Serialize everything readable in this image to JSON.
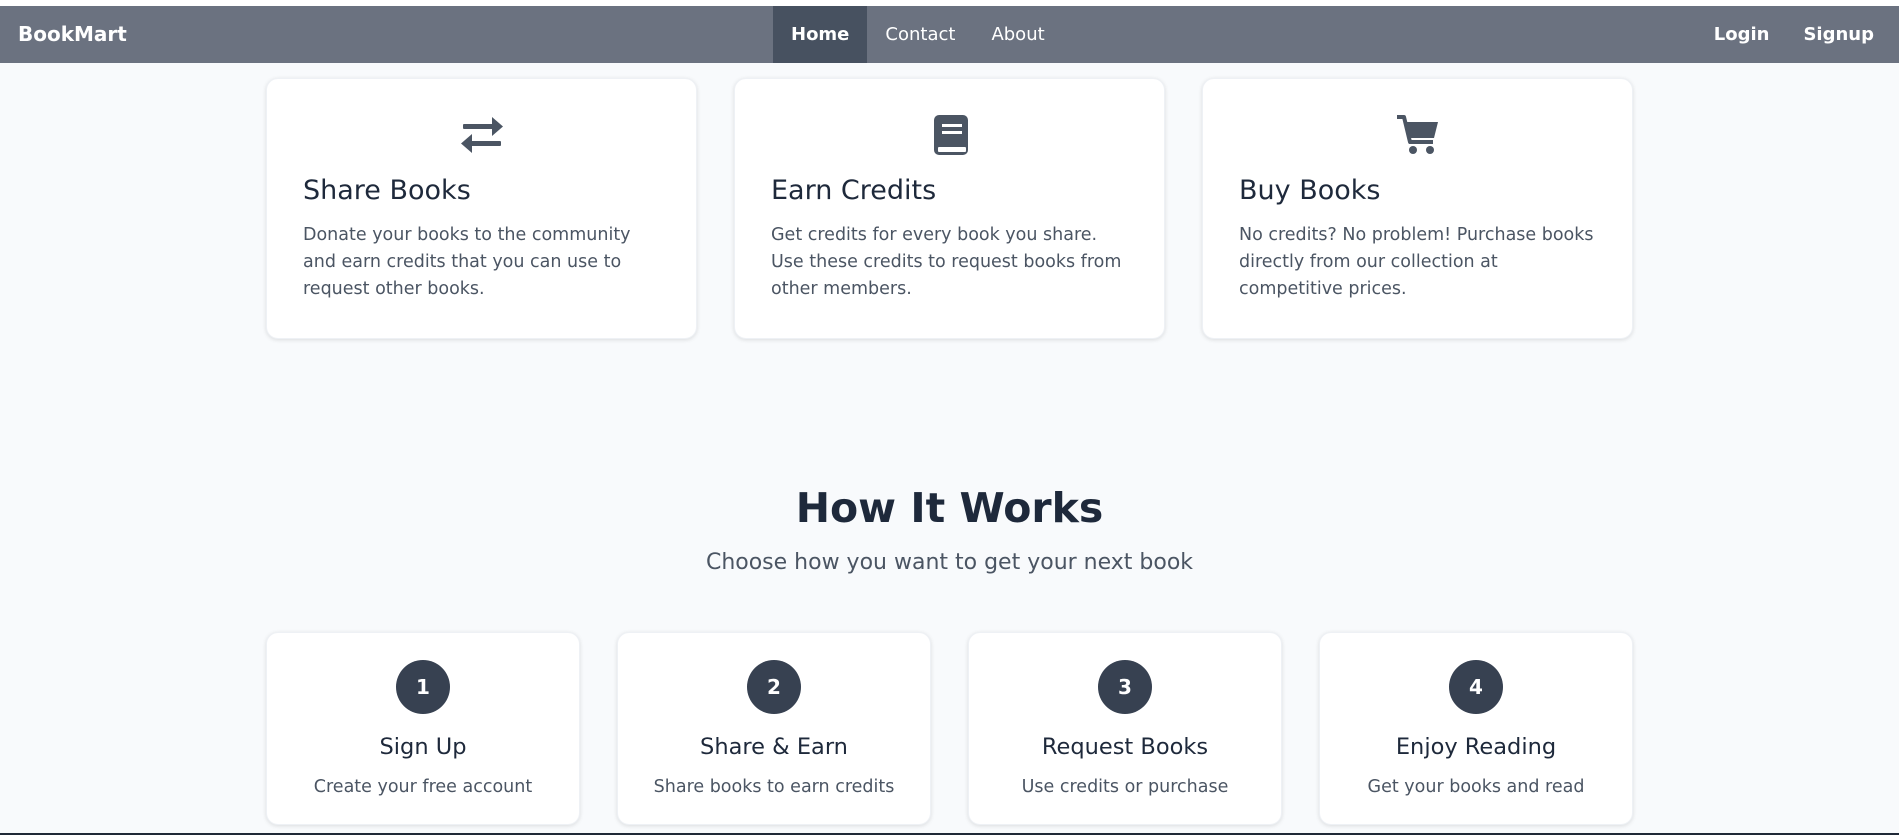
{
  "navbar": {
    "brand": "BookMart",
    "links": [
      {
        "label": "Home",
        "active": true
      },
      {
        "label": "Contact",
        "active": false
      },
      {
        "label": "About",
        "active": false
      }
    ],
    "auth": [
      {
        "label": "Login"
      },
      {
        "label": "Signup"
      }
    ]
  },
  "features": [
    {
      "icon": "exchange-arrows-icon",
      "title": "Share Books",
      "description": "Donate your books to the community and earn credits that you can use to request other books."
    },
    {
      "icon": "book-icon",
      "title": "Earn Credits",
      "description": "Get credits for every book you share. Use these credits to request books from other members."
    },
    {
      "icon": "shopping-cart-icon",
      "title": "Buy Books",
      "description": "No credits? No problem! Purchase books directly from our collection at competitive prices."
    }
  ],
  "how_it_works": {
    "title": "How It Works",
    "subtitle": "Choose how you want to get your next book",
    "steps": [
      {
        "number": "1",
        "title": "Sign Up",
        "description": "Create your free account"
      },
      {
        "number": "2",
        "title": "Share & Earn",
        "description": "Share books to earn credits"
      },
      {
        "number": "3",
        "title": "Request Books",
        "description": "Use credits or purchase"
      },
      {
        "number": "4",
        "title": "Enjoy Reading",
        "description": "Get your books and read"
      }
    ]
  },
  "colors": {
    "navbar_bg": "#6b7280",
    "nav_active_bg": "#475160",
    "step_badge_bg": "#374151",
    "icon_color": "#4b5563"
  }
}
